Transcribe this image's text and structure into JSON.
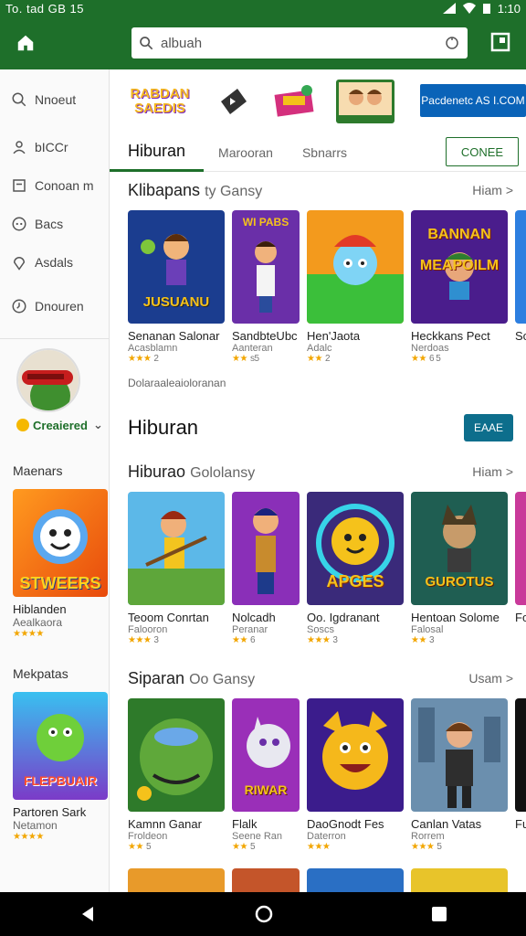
{
  "status_bar": {
    "left": "To. tad  GB 15",
    "right": "1:10"
  },
  "search": {
    "placeholder": "albuah"
  },
  "sidebar": {
    "items": [
      {
        "label": "Nnoeut",
        "icon": "search-icon"
      },
      {
        "label": "bICCr",
        "icon": "person-icon"
      },
      {
        "label": "Conoan  m",
        "icon": "box-icon"
      },
      {
        "label": "Bacs",
        "icon": "compass-icon"
      },
      {
        "label": "Asdals",
        "icon": "pin-icon"
      },
      {
        "label": "Dnouren",
        "icon": "clock-icon"
      }
    ],
    "created_label": "Creaiered",
    "sections": [
      {
        "title": "Maenars",
        "card": {
          "name": "Hiblanden",
          "dev": "Aealkaora",
          "rating": "★★★★"
        },
        "art_text": "STWEERS"
      },
      {
        "title": "Mekpatas",
        "card": {
          "name": "Partoren Sark",
          "dev": "Netamon",
          "rating": "★★★★"
        },
        "art_text": "FLEPBUAIR"
      }
    ]
  },
  "brands": {
    "logo1": "RABDAN SAEDIS",
    "cta": "Pacdenetc AS I.COM"
  },
  "tabs": [
    {
      "label": "Hiburan",
      "active": true
    },
    {
      "label": "Marooran",
      "active": false
    },
    {
      "label": "Sbnarrs",
      "active": false
    }
  ],
  "connect_label": "CONEE",
  "section1": {
    "title": "Klibapans",
    "subtitle": "ty Gansy",
    "more": "Hiam >",
    "cards": [
      {
        "name": "Senanan Salonar",
        "dev": "Acasblamn",
        "rating": "★★★",
        "rc": "2",
        "art": "JUSUANU"
      },
      {
        "name": "SandbteUbc",
        "dev": "Aanteran",
        "rating": "★★",
        "rc": "s5",
        "art": "WI PABS"
      },
      {
        "name": "Hen'Jaota",
        "dev": "Adalc",
        "rating": "★★",
        "rc": "2",
        "art": ""
      },
      {
        "name": "Heckkans Pect",
        "dev": "Nerdoas",
        "rating": "★★",
        "rc": "6 5",
        "art": "BANNAN MEAPOILM"
      },
      {
        "name": "So",
        "dev": "",
        "rating": "",
        "rc": "",
        "art": ""
      }
    ],
    "caption": "Dolaraaleaioloranan"
  },
  "hero": {
    "title": "Hiburan",
    "button": "EAAE"
  },
  "section2": {
    "title": "Hiburao",
    "subtitle": "Gololansy",
    "more": "Hiam >",
    "cards": [
      {
        "name": "Teoom Conrtan",
        "dev": "Falooron",
        "rating": "★★★",
        "rc": "3",
        "art": ""
      },
      {
        "name": "Nolcadh",
        "dev": "Peranar",
        "rating": "★★",
        "rc": "6",
        "art": ""
      },
      {
        "name": "Oo. Igdranant",
        "dev": "Soscs",
        "rating": "★★★",
        "rc": "3",
        "art": "APGES"
      },
      {
        "name": "Hentoan Solome",
        "dev": "Falosal",
        "rating": "★★",
        "rc": "3",
        "art": "GUROTUS"
      },
      {
        "name": "Fo",
        "dev": "",
        "rating": "",
        "rc": "",
        "art": ""
      }
    ]
  },
  "section3": {
    "title": "Siparan",
    "subtitle": "Oo Gansy",
    "more": "Usam >",
    "cards": [
      {
        "name": "Kamnn Ganar",
        "dev": "Froldeon",
        "rating": "★★",
        "rc": "5",
        "art": ""
      },
      {
        "name": "Flalk",
        "dev": "Seene Ran",
        "rating": "★★",
        "rc": "5",
        "art": "RIWAR"
      },
      {
        "name": "DaoGnodt Fes",
        "dev": "Daterron",
        "rating": "★★★",
        "rc": "",
        "art": ""
      },
      {
        "name": "Canlan Vatas",
        "dev": "Rorrem",
        "rating": "★★★",
        "rc": "5",
        "art": ""
      },
      {
        "name": "Fu",
        "dev": "",
        "rating": "",
        "rc": "",
        "art": ""
      }
    ]
  },
  "colors": {
    "primary": "#1e6f2a",
    "cta": "#0a63b8",
    "hero_button": "#0d6e8c",
    "star": "#f2a600"
  }
}
